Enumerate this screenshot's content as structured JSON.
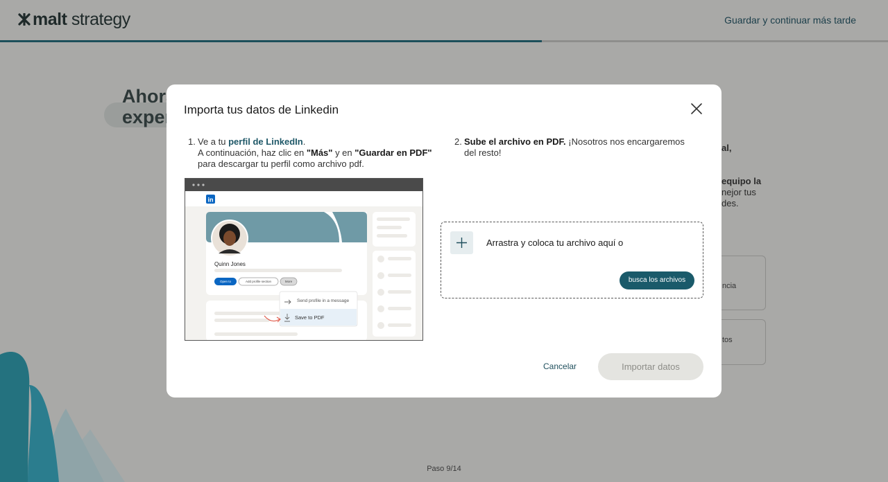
{
  "header": {
    "logo_bold": "malt",
    "logo_light": " strategy",
    "save_later": "Guardar y continuar más tarde",
    "progress_fraction": 0.61
  },
  "background": {
    "title_line1": "Ahora",
    "title_line2": "exper",
    "side_texts": [
      "al,",
      "equipo la",
      "nejor tus",
      "des."
    ],
    "card_texts": [
      "ncia",
      "tos"
    ],
    "step_counter": "Paso 9/14"
  },
  "modal": {
    "title": "Importa tus datos de Linkedin",
    "step1": {
      "num": "1.",
      "prefix": "Ve a tu ",
      "link": "perfil de LinkedIn",
      "period": ".",
      "line2_a": "A continuación, haz clic en ",
      "mas": "\"Más\"",
      "line2_b": " y en ",
      "guardar": "\"Guardar en PDF\"",
      "line3": " para descargar tu perfil como archivo pdf."
    },
    "step2": {
      "num": "2.",
      "bold": "Sube el archivo en PDF.",
      "rest": " ¡Nosotros nos encargaremos del resto!"
    },
    "illustration": {
      "profile_name": "Quinn Jones",
      "btn_open": "Open to",
      "btn_add": "Add profile section",
      "btn_more": "More",
      "menu_send": "Send profile in a message",
      "menu_save": "Save to PDF",
      "linkedin_color": "#0a66c2"
    },
    "dropzone": {
      "text": "Arrastra y coloca tu archivo aquí o",
      "browse": "busca los archivos"
    },
    "cancel": "Cancelar",
    "import": "Importar datos"
  },
  "colors": {
    "accent": "#1a5a6a",
    "overlay_bg": "#a9a9a7"
  }
}
